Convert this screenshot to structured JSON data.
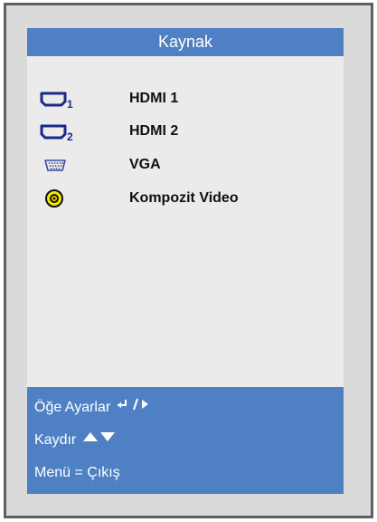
{
  "menu": {
    "title": "Kaynak",
    "items": [
      {
        "label": "HDMI 1",
        "icon": "hdmi-1-icon"
      },
      {
        "label": "HDMI 2",
        "icon": "hdmi-2-icon"
      },
      {
        "label": "VGA",
        "icon": "vga-icon"
      },
      {
        "label": "Kompozit Video",
        "icon": "composite-video-icon"
      }
    ],
    "hdmi1_index": "1",
    "hdmi2_index": "2"
  },
  "footer": {
    "select_label": "Öğe Ayarlar",
    "scroll_label": "Kaydır",
    "exit_label": "Menü = Çıkış"
  },
  "colors": {
    "accent": "#4f80c4",
    "panel": "#ebebeb",
    "frame": "#dadada",
    "border": "#5e6060",
    "composite_yellow": "#f4e400"
  }
}
